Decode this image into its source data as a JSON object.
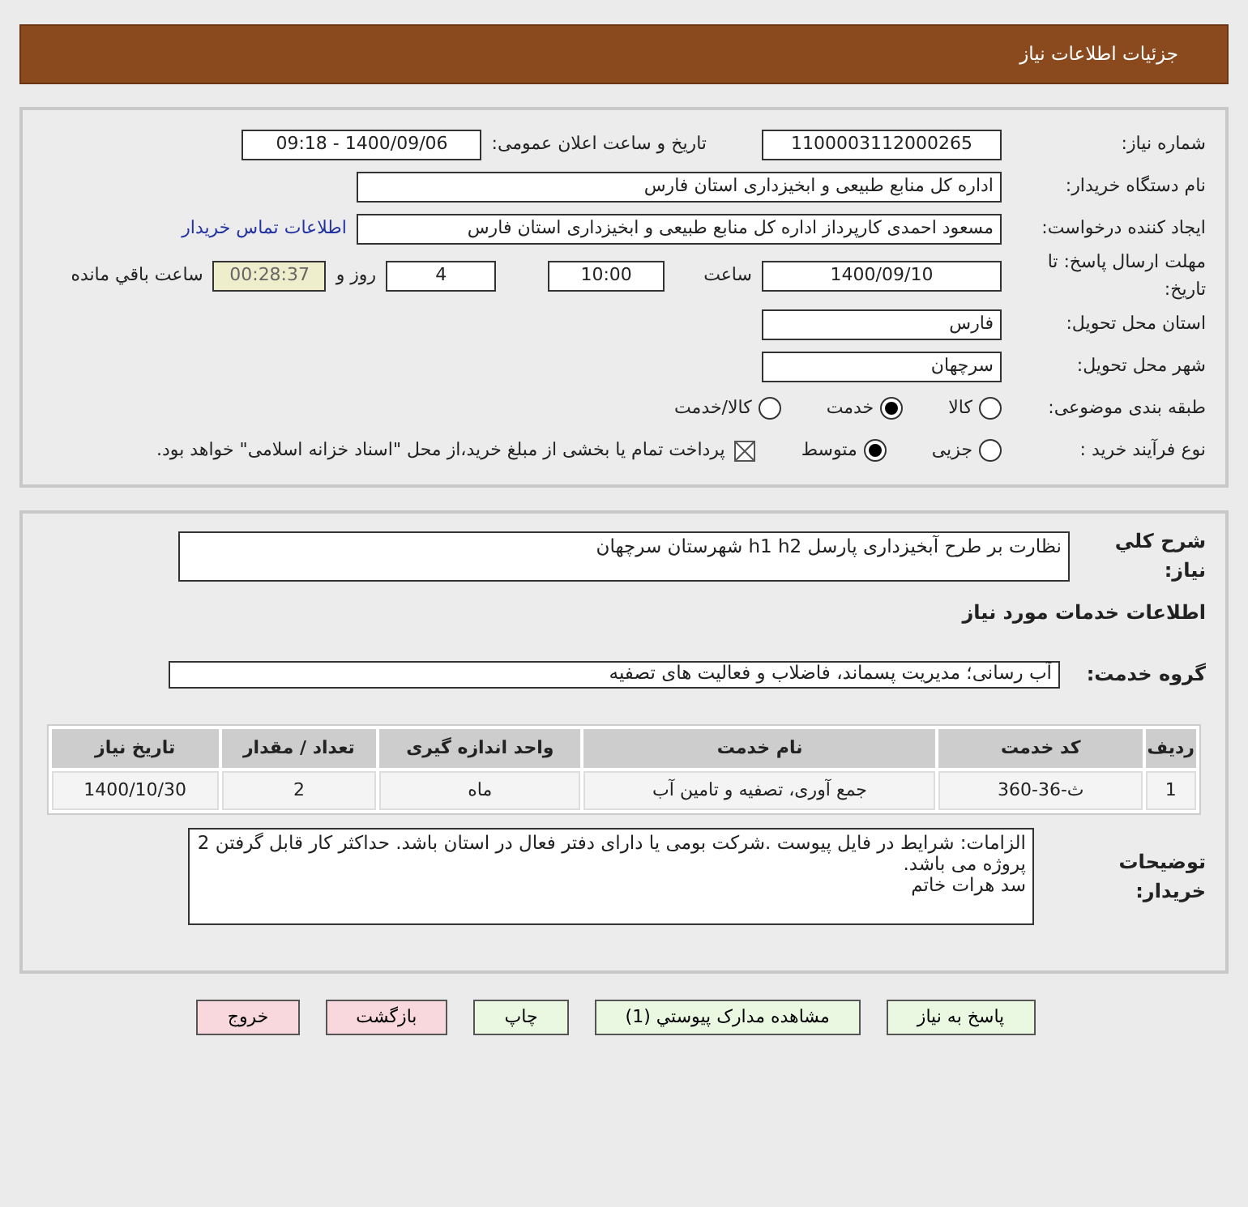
{
  "header": {
    "title": "جزئیات اطلاعات نیاز"
  },
  "need_number": {
    "label": "شماره نیاز:",
    "value": "1100003112000265"
  },
  "announce": {
    "label": "تاریخ و ساعت اعلان عمومی:",
    "value": "1400/09/06 - 09:18"
  },
  "buyer_org": {
    "label": "نام دستگاه خریدار:",
    "value": "اداره کل منابع طبیعی و ابخیزداری استان فارس"
  },
  "requester": {
    "label": "ایجاد کننده درخواست:",
    "value": "مسعود احمدی کارپرداز اداره کل منابع طبیعی و ابخیزداری استان فارس",
    "link": "اطلاعات تماس خریدار"
  },
  "deadline": {
    "label": "مهلت ارسال پاسخ: تا تاریخ:",
    "date": "1400/09/10",
    "time_label": "ساعت",
    "time": "10:00",
    "days": "4",
    "days_label": "روز و",
    "remaining": "00:28:37",
    "remaining_label": "ساعت باقي مانده"
  },
  "province": {
    "label": "استان محل تحویل:",
    "value": "فارس"
  },
  "city": {
    "label": "شهر محل تحویل:",
    "value": "سرچهان"
  },
  "category": {
    "label": "طبقه بندی موضوعی:",
    "options": [
      {
        "label": "کالا",
        "selected": false
      },
      {
        "label": "خدمت",
        "selected": true
      },
      {
        "label": "کالا/خدمت",
        "selected": false
      }
    ]
  },
  "process": {
    "label": "نوع فرآیند خرید :",
    "options": [
      {
        "label": "جزیی",
        "selected": false
      },
      {
        "label": "متوسط",
        "selected": true
      }
    ],
    "treasury": {
      "label": "پرداخت تمام یا بخشی از مبلغ خرید،از محل \"اسناد خزانه اسلامی\" خواهد بود.",
      "checked": true
    }
  },
  "description": {
    "label": "شرح کلي نیاز:",
    "value": "نظارت بر طرح آبخیزداری پارسل h1 h2 شهرستان سرچهان"
  },
  "services_heading": "اطلاعات خدمات مورد نیاز",
  "service_group": {
    "label": "گروه خدمت:",
    "value": "آب رسانی؛ مدیریت پسماند، فاضلاب و فعالیت های تصفیه"
  },
  "table": {
    "columns": [
      "ردیف",
      "کد خدمت",
      "نام خدمت",
      "واحد اندازه گیری",
      "تعداد / مقدار",
      "تاریخ نیاز"
    ],
    "rows": [
      [
        "1",
        "ث-36-360",
        "جمع آوری، تصفیه و تامین آب",
        "ماه",
        "2",
        "1400/10/30"
      ]
    ]
  },
  "buyer_notes": {
    "label": "توضیحات خریدار:",
    "lines": [
      "الزامات: شرایط در فایل پیوست .شرکت بومی یا دارای دفتر فعال در استان باشد. حداکثر کار قابل گرفتن 2 پروژه می باشد.",
      "سد هرات خاتم"
    ]
  },
  "buttons": [
    {
      "label": "پاسخ به نیاز",
      "color": "#eaf8e2"
    },
    {
      "label": "مشاهده مدارک پیوستي (1)",
      "color": "#eaf8e2"
    },
    {
      "label": "چاپ",
      "color": "#eaf8e2"
    },
    {
      "label": "بازگشت",
      "color": "#f8d8dc"
    },
    {
      "label": "خروج",
      "color": "#f8d8dc"
    }
  ]
}
